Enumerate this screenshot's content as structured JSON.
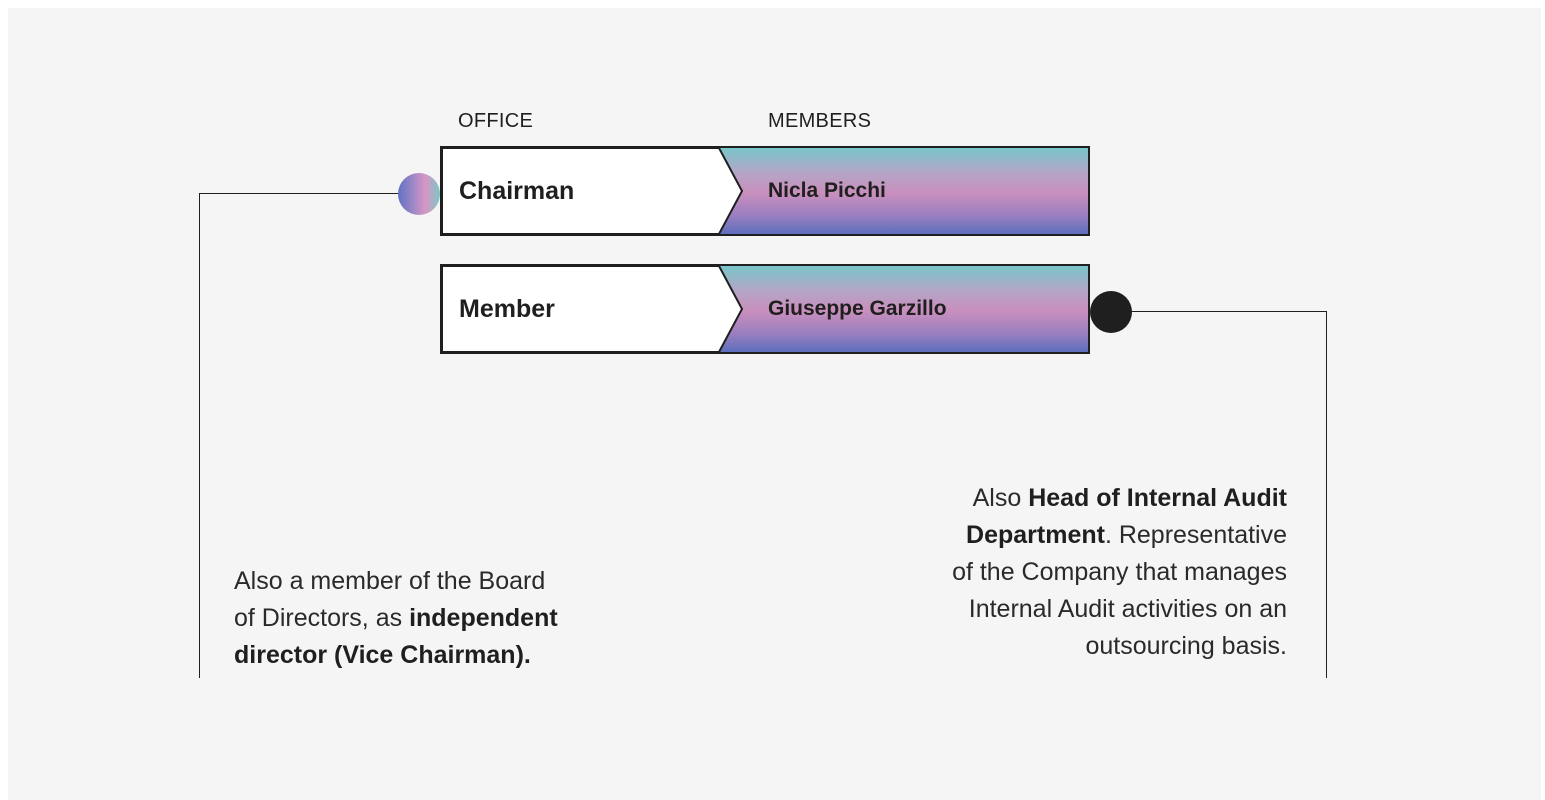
{
  "headers": {
    "office": "OFFICE",
    "members": "MEMBERS"
  },
  "rows": [
    {
      "office": "Chairman",
      "member": "Nicla Picchi"
    },
    {
      "office": "Member",
      "member": "Giuseppe Garzillo"
    }
  ],
  "notes": {
    "left": {
      "line1": "Also a member of the Board",
      "line2_prefix": "of Directors, as ",
      "line2_bold": "independent",
      "line3_bold": "director (Vice Chairman)."
    },
    "right": {
      "line1_prefix": "Also ",
      "line1_bold": "Head of Internal Audit",
      "line2_bold": "Department",
      "line2_suffix": ". Representative",
      "line3": "of the Company that manages",
      "line4": "Internal Audit activities on an",
      "line5": "outsourcing basis."
    }
  },
  "colors": {
    "background": "#f5f5f5",
    "ink": "#1f1f1f",
    "gradient_top": "#79c6c9",
    "gradient_mid": "#c98fbd",
    "gradient_bottom": "#5e6fbd"
  }
}
